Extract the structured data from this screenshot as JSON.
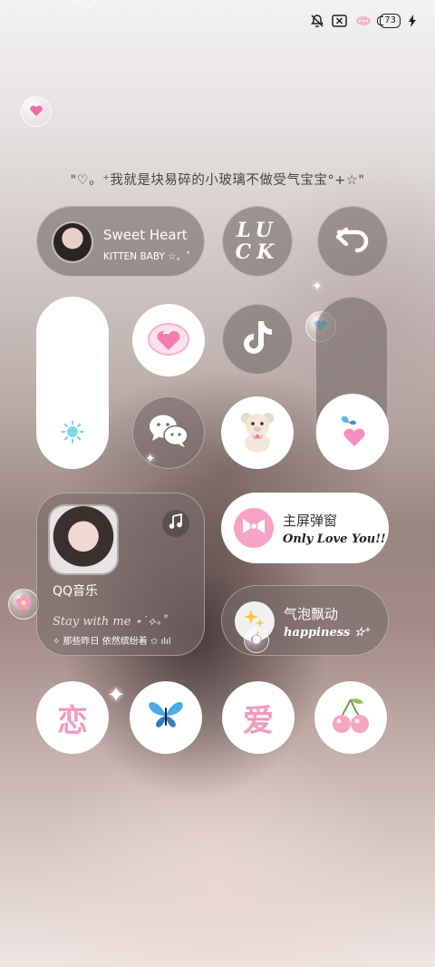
{
  "status": {
    "battery": "73"
  },
  "quote": "\"♡。⁺我就是块易碎的小玻璃不做受气宝宝°+☆\"",
  "sweet": {
    "title": "Sweet Heart",
    "subtitle": "KITTEN BABY ☆。˚"
  },
  "luck": {
    "l": "L",
    "u": "U",
    "c": "C",
    "k": "K"
  },
  "music": {
    "app": "QQ音乐",
    "song": "Stay with me ⋆˙⟡₊˚",
    "lyric": "✧ 那些昨日 依然缤纷着 ✩ ılıl"
  },
  "popup": {
    "title": "主屏弹窗",
    "subtitle": "Only Love You!!"
  },
  "bubble": {
    "title": "气泡飘动",
    "subtitle": "happiness ☆⁺"
  },
  "dock": [
    {
      "text": "恋"
    },
    {
      "text": "🦋"
    },
    {
      "text": "爱"
    },
    {
      "text": "🍒"
    }
  ],
  "colors": {
    "pink": "#f7a3c4",
    "card": "#786c6a"
  },
  "icons": [
    "music-note-icon",
    "back-arrow-icon",
    "tiktok-icon",
    "wechat-icon",
    "sun-icon",
    "heart-icon",
    "teddy-bear-icon",
    "butterfly-icon",
    "bow-icon",
    "cherry-icon",
    "unicorn-icon",
    "sparkles-icon"
  ]
}
